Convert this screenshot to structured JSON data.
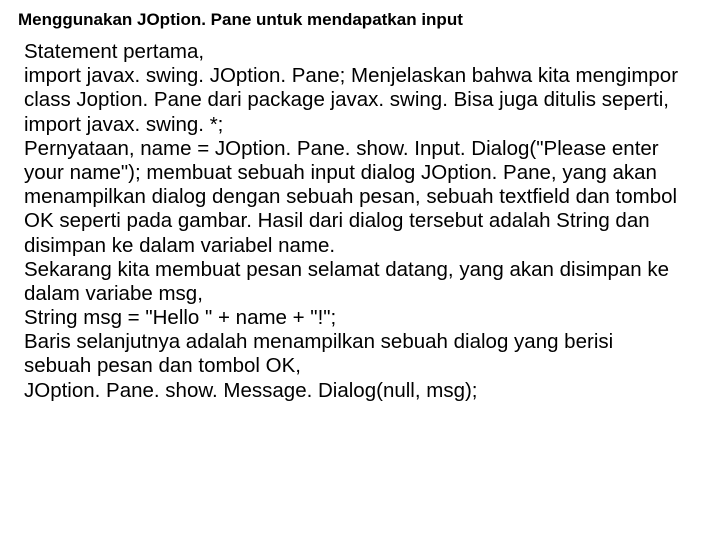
{
  "title": "Menggunakan JOption. Pane untuk mendapatkan input",
  "body": "Statement pertama,\nimport javax. swing. JOption. Pane; Menjelaskan bahwa kita mengimpor class Joption. Pane dari package javax. swing. Bisa juga ditulis seperti,\nimport javax. swing. *;\nPernyataan, name = JOption. Pane. show. Input. Dialog(\"Please enter your name\"); membuat sebuah input dialog JOption. Pane, yang akan menampilkan dialog dengan sebuah pesan, sebuah textfield dan tombol OK seperti pada gambar. Hasil dari dialog tersebut adalah String dan disimpan ke dalam variabel name.\nSekarang kita membuat pesan selamat datang, yang akan disimpan ke dalam variabe msg,\nString msg = \"Hello \" + name + \"!\";\nBaris selanjutnya adalah menampilkan sebuah dialog yang berisi sebuah  pesan dan tombol OK,\nJOption. Pane. show. Message. Dialog(null, msg);"
}
